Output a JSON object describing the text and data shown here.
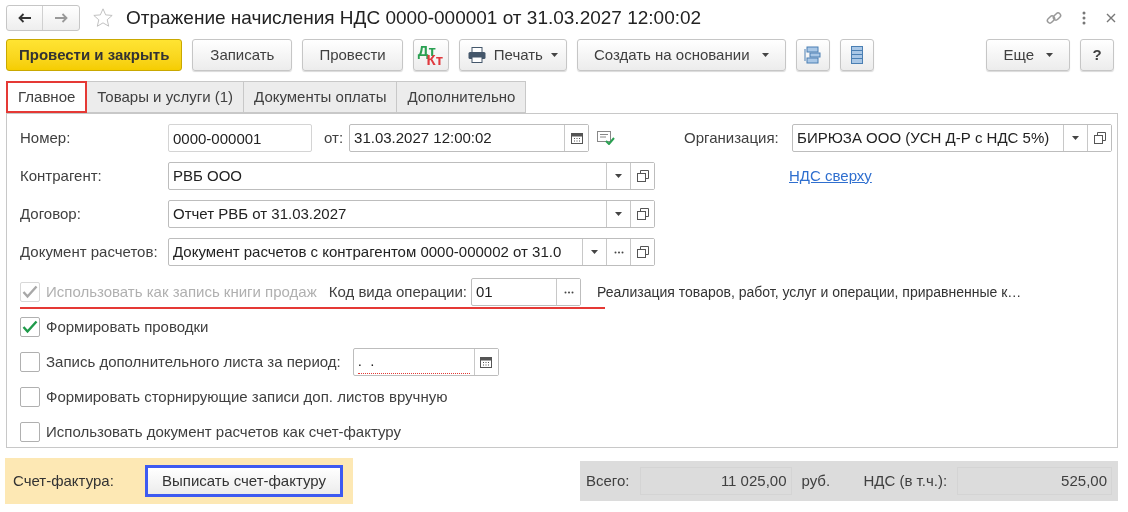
{
  "window": {
    "title": "Отражение начисления НДС 0000-000001 от 31.03.2027 12:00:02",
    "favorite": false
  },
  "toolbar": {
    "left": [
      {
        "kind": "primary",
        "label": "Провести и закрыть"
      },
      {
        "kind": "plain",
        "label": "Записать"
      },
      {
        "kind": "plain",
        "label": "Провести"
      },
      {
        "kind": "dtkt",
        "label_top": "Дт",
        "label_bottom": "Кт"
      },
      {
        "kind": "print",
        "label": "Печать"
      },
      {
        "kind": "menu",
        "label": "Создать на основании"
      },
      {
        "kind": "structure"
      },
      {
        "kind": "list"
      }
    ],
    "right": [
      {
        "kind": "menu",
        "label": "Еще"
      },
      {
        "kind": "plain",
        "label": "?"
      }
    ]
  },
  "tabs": [
    {
      "label": "Главное",
      "selected": true
    },
    {
      "label": "Товары и услуги (1)",
      "selected": false
    },
    {
      "label": "Документы оплаты",
      "selected": false
    },
    {
      "label": "Дополнительно",
      "selected": false
    }
  ],
  "form": {
    "number": {
      "label": "Номер:",
      "value": "0000-000001"
    },
    "date": {
      "label": "от:",
      "value": "31.03.2027 12:00:02"
    },
    "organization": {
      "label": "Организация:",
      "value": "БИРЮЗА ООО (УСН Д-Р с НДС 5%)"
    },
    "fields": [
      {
        "label": "Контрагент:",
        "value": "РВБ ООО",
        "kind": "select"
      },
      {
        "label": "Договор:",
        "value": "Отчет РВБ от 31.03.2027",
        "kind": "select"
      },
      {
        "label": "Документ расчетов:",
        "value": "Документ расчетов с контрагентом 0000-000002 от 31.0",
        "kind": "select_choose"
      }
    ],
    "link": "НДС сверху",
    "sales_book": {
      "label": "Использовать как запись книги продаж",
      "checked": true,
      "disabled": true,
      "highlighted": true,
      "code_label": "Код вида операции:",
      "code_value": "01",
      "code_description": "Реализация товаров, работ, услуг и операции, приравненные к…"
    },
    "checkboxes": [
      {
        "kind": "plain",
        "label": "Формировать проводки",
        "checked": true
      },
      {
        "kind": "period",
        "label": "Запись дополнительного листа за период:",
        "checked": false,
        "date_value": ".  .",
        "required": true
      },
      {
        "kind": "plain",
        "label": "Формировать сторнирующие записи доп. листов вручную",
        "checked": false
      },
      {
        "kind": "plain",
        "label": "Использовать документ расчетов как счет-фактуру",
        "checked": false
      }
    ]
  },
  "invoice": {
    "label": "Счет-фактура:",
    "button": "Выписать счет-фактуру",
    "highlighted": true
  },
  "totals": {
    "total_label": "Всего:",
    "total_value": "11 025,00",
    "currency": "руб.",
    "vat_label": "НДС (в т.ч.):",
    "vat_value": "525,00"
  }
}
